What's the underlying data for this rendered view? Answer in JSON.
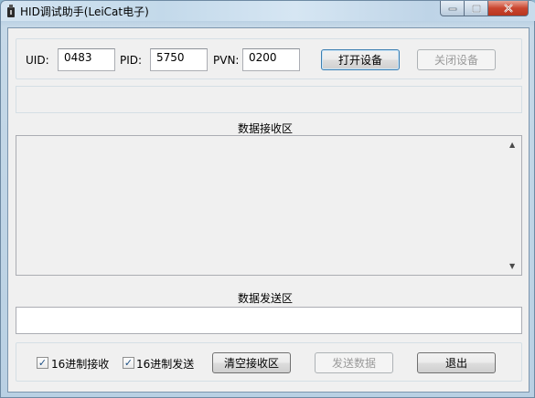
{
  "window": {
    "title": "HID调试助手(LeiCat电子)"
  },
  "device": {
    "uid_label": "UID:",
    "uid_value": "0483",
    "pid_label": "PID:",
    "pid_value": "5750",
    "pvn_label": "PVN:",
    "pvn_value": "0200",
    "open_label": "打开设备",
    "close_label": "关闭设备"
  },
  "receive": {
    "title": "数据接收区",
    "content": ""
  },
  "send": {
    "title": "数据发送区",
    "content": ""
  },
  "bottom": {
    "hex_receive_label": "16进制接收",
    "hex_send_label": "16进制发送",
    "clear_label": "清空接收区",
    "send_label": "发送数据",
    "exit_label": "退出",
    "hex_receive_checked": true,
    "hex_send_checked": true
  },
  "icons": {
    "app": "usb-icon",
    "minimize": "minimize-icon",
    "maximize": "maximize-icon",
    "close": "close-icon",
    "scroll_up": "scroll-up-icon",
    "scroll_down": "scroll-down-icon",
    "check": "check-icon"
  }
}
